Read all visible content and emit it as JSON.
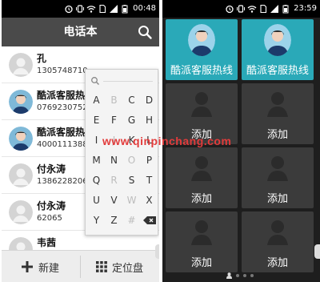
{
  "left_phone": {
    "status_time": "00:48",
    "title": "电话本",
    "contacts": [
      {
        "name": "孔",
        "number": "1305748710"
      },
      {
        "name": "酷派客服热",
        "number": "0769230752"
      },
      {
        "name": "酷派客服热",
        "number": "4000111388"
      },
      {
        "name": "付永涛",
        "number": "1386228206"
      },
      {
        "name": "付永涛",
        "number": "62065"
      },
      {
        "name": "韦茜",
        "number": ""
      }
    ],
    "alphabet": [
      "A",
      "B",
      "C",
      "D",
      "E",
      "F",
      "G",
      "H",
      "I",
      "J",
      "K",
      "L",
      "M",
      "N",
      "O",
      "P",
      "Q",
      "R",
      "S",
      "T",
      "U",
      "V",
      "W",
      "X",
      "Y",
      "Z",
      "#"
    ],
    "active_letters": [
      "A",
      "C",
      "D",
      "E",
      "F",
      "G",
      "H",
      "I",
      "K",
      "L",
      "M",
      "N",
      "P",
      "Q",
      "S",
      "T",
      "U",
      "V",
      "X",
      "Y",
      "Z"
    ],
    "new_label": "新建",
    "dialpad_label": "定位盘"
  },
  "right_phone": {
    "status_time": "23:59",
    "tiles": [
      {
        "type": "contact",
        "label": "酷派客服热线"
      },
      {
        "type": "contact",
        "label": "酷派客服热线"
      },
      {
        "type": "add",
        "label": "添加"
      },
      {
        "type": "add",
        "label": "添加"
      },
      {
        "type": "add",
        "label": "添加"
      },
      {
        "type": "add",
        "label": "添加"
      },
      {
        "type": "add",
        "label": "添加"
      },
      {
        "type": "add",
        "label": "添加"
      }
    ]
  },
  "watermark": "www.qinpinchang.com",
  "colors": {
    "title_bar": "#4a4a4a",
    "tile_teal": "#2aa9b8",
    "tile_dark": "#3b3b3b",
    "watermark": "#e23b3b"
  }
}
